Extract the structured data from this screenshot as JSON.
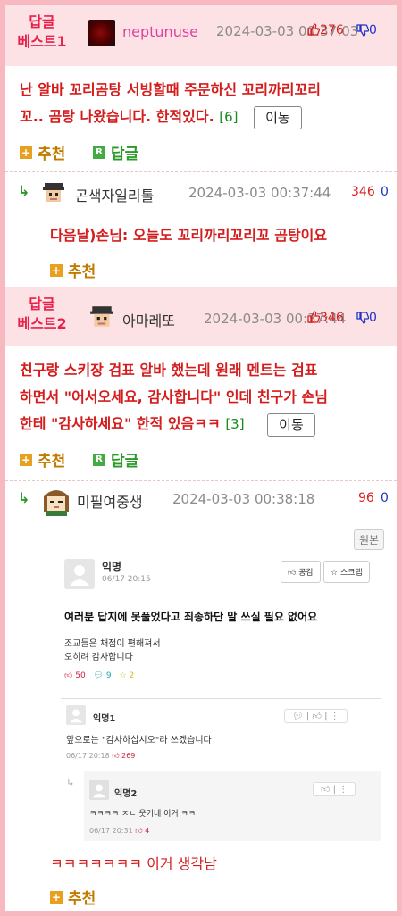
{
  "c1": {
    "badge1": "답글",
    "badge2": "베스트1",
    "nick": "neptunuse",
    "date": "2024-03-03 00:37:03",
    "up": "276",
    "down": "0",
    "text1": "난 알바 꼬리곰탕 서빙할때 주문하신 꼬리까리꼬리",
    "text2": "꼬.. 곰탕 나왔습니다. 한적있다.",
    "count": "[6]",
    "move": "이동",
    "rec": "추천",
    "reply": "답글",
    "reply_badge": "R",
    "plus": "+"
  },
  "r1": {
    "nick": "곤색자일리톨",
    "date": "2024-03-03 00:37:44",
    "up": "346",
    "down": "0",
    "text": "다음날)손님: 오늘도 꼬리까리꼬리꼬 곰탕이요",
    "rec": "추천",
    "arrow": "↳"
  },
  "c2": {
    "badge1": "답글",
    "badge2": "베스트2",
    "nick": "아마레또",
    "date": "2024-03-03 00:37:44",
    "up": "346",
    "down": "0",
    "text1": "친구랑 스키장 검표 알바 했는데 원래 멘트는 검표",
    "text2": "하면서 \"어서오세요, 감사합니다\" 인데 친구가 손님",
    "text3": "한테 \"감사하세요\" 한적 있음ㅋㅋ",
    "count": "[3]",
    "move": "이동",
    "rec": "추천",
    "reply": "답글",
    "reply_badge": "R"
  },
  "r2": {
    "nick": "미필여중생",
    "date": "2024-03-03 00:38:18",
    "up": "96",
    "down": "0",
    "original": "원본",
    "text": "ㅋㅋㅋㅋㅋㅋㅋ 이거 생각남",
    "rec": "추천",
    "arrow": "↳"
  },
  "shot": {
    "author": "익명",
    "time": "06/17 20:15",
    "like_btn": "공감",
    "scrap_btn": "스크랩",
    "title": "여러분 답지에 못풀었다고 죄송하단 말 쓰실 필요 없어요",
    "body1": "조교들은 채점이 편해져서",
    "body2": "오히려 감사합니다",
    "likes": "50",
    "comments": "9",
    "stars": "2",
    "c1_author": "익명1",
    "c1_text": "앞으로는 \"감사하십시오\"라 쓰겠습니다",
    "c1_time": "06/17 20:18",
    "c1_likes": "269",
    "c2_author": "익명2",
    "c2_text": "ㅋㅋㅋㅋ ㅈㄴ 웃기네 이거 ㅋㅋ",
    "c2_time": "06/17 20:31",
    "c2_likes": "4"
  },
  "colors": {
    "frame": "#f8b8c0",
    "best_bg": "#fde2e5",
    "badge": "#e8204a",
    "body_red": "#d41c1c",
    "up": "#d61e1e",
    "down": "#1e32c8",
    "nick_pink": "#e040a0"
  }
}
